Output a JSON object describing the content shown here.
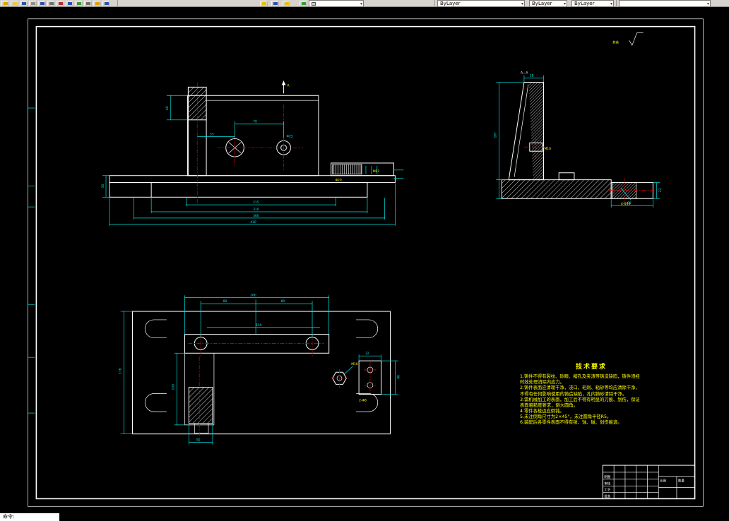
{
  "toolbar": {
    "combos": [
      {
        "label": "ByLayer"
      },
      {
        "label": "ByLayer"
      },
      {
        "label": "ByLayer"
      }
    ]
  },
  "command_line": {
    "prompt": "命令:"
  },
  "sheet": {
    "surface_note": "其余",
    "section_title": "A—A",
    "section_mark": "A",
    "tech": {
      "title": "技术要求",
      "items": [
        "1.铸件不得有裂纹、砂眼、缩孔及夹渣等铸造缺陷，铸件须经时效处理消除内应力。",
        "2.铸件表面应清理干净，浇口、毛刺、粘砂等均应清除干净，不得有任何影响使用的铸造缺陷，孔内铸砂清除干净。",
        "3.需机械加工的表面，加工后不得有明显的刀痕、划伤，保证表面粗糙度要求，倒大圆角。",
        "4.零件各棱边应倒钝。",
        "5.未注倒角尺寸为2×45°，未注圆角半径R5。",
        "6.装配后各零件表面不得有锈、蚀、碰、划伤痕迹。"
      ]
    },
    "dims": {
      "front": {
        "col_h": "40",
        "cc": "70",
        "col_c1": "55",
        "b1": "215",
        "b2": "310",
        "b3": "360",
        "b4": "410",
        "base_h": "30",
        "hole": "Φ25",
        "m": "M12",
        "p": "Φ20"
      },
      "section": {
        "top": "28",
        "left_h": "167",
        "step": "23",
        "bot": "60",
        "holes": "4-Φ13",
        "m": "M10"
      },
      "plan": {
        "outer": "280",
        "seg1": "80",
        "seg2": "80",
        "inner": "150",
        "left": "176",
        "leg": "100",
        "plate_w": "32",
        "plate_h": "48",
        "slot": "34",
        "m": "M16",
        "holes": "2-Φ8"
      }
    },
    "title_block": {
      "labels": [
        "制图",
        "审核",
        "工艺",
        "批准",
        "比例",
        "数量"
      ]
    }
  }
}
